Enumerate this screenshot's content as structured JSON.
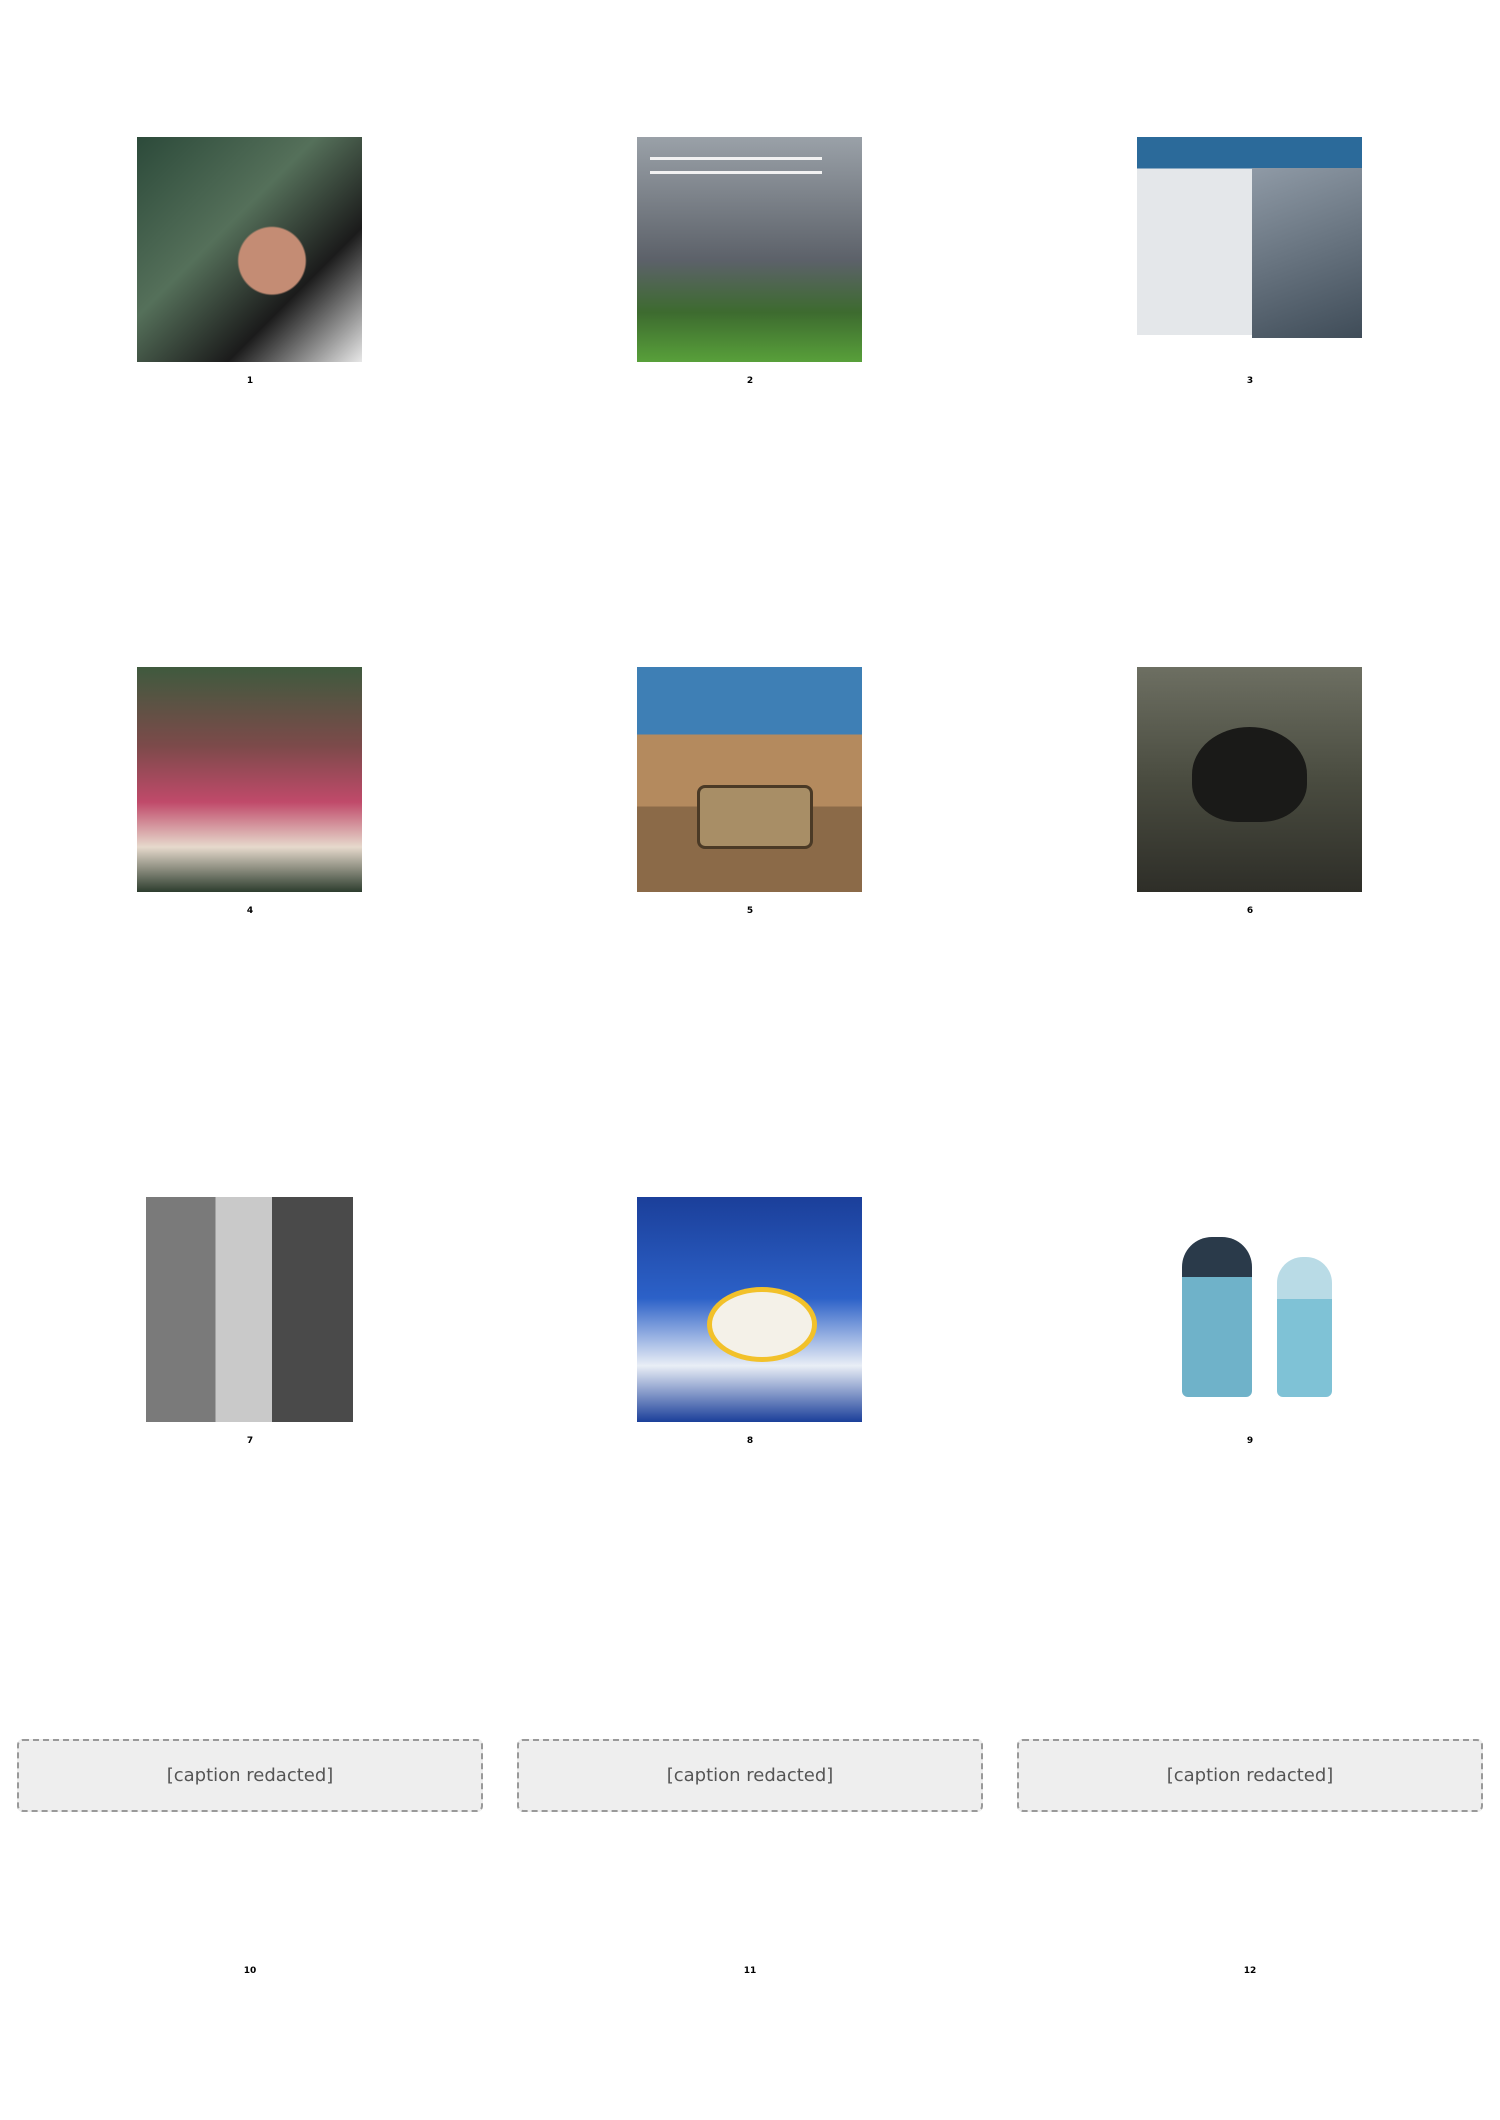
{
  "grid": {
    "cells": [
      {
        "number": "1",
        "image": "couple-kissing-photo"
      },
      {
        "number": "2",
        "image": "music-of-the-storms-poster"
      },
      {
        "number": "3",
        "image": "this-not-that-skincare-ad"
      },
      {
        "number": "4",
        "image": "ceremony-crowd-photo"
      },
      {
        "number": "5",
        "image": "30-hours-in-a-car-road-trip-photo"
      },
      {
        "number": "6",
        "image": "confession-bear-meme"
      },
      {
        "number": "7",
        "image": "vintage-couple-photo"
      },
      {
        "number": "8",
        "image": "sole-distributor-wanted-ad"
      },
      {
        "number": "9",
        "image": "comic-sketch-two-figures"
      },
      {
        "number": "10",
        "note": "[caption redacted]"
      },
      {
        "number": "11",
        "note": "[caption redacted]"
      },
      {
        "number": "12",
        "note": "[caption redacted]"
      }
    ]
  }
}
